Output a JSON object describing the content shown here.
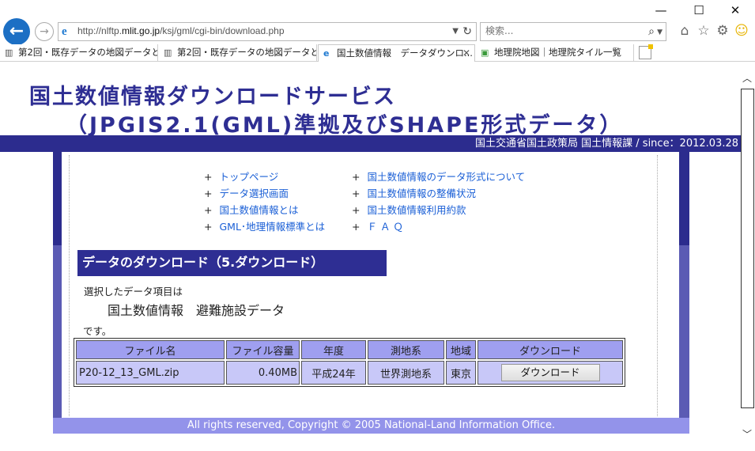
{
  "window": {
    "minimize": "—",
    "maximize": "☐",
    "close": "✕"
  },
  "toolbar": {
    "back_icon": "←",
    "forward_icon": "→",
    "url_prefix": "http://nlftp.",
    "url_domain": "mlit.go.jp",
    "url_path": "/ksj/gml/cgi-bin/download.php",
    "search_placeholder": "検索...",
    "icons": [
      "home-icon",
      "favorites-star-icon",
      "settings-gear-icon",
      "smiley-feedback-icon"
    ]
  },
  "tabs": [
    {
      "label": "第2回・既存データの地図データと...",
      "icon": "book-icon"
    },
    {
      "label": "第2回・既存データの地図データと...",
      "icon": "book-icon"
    },
    {
      "label": "国土数値情報　データダウンロ...",
      "icon": "ie-icon",
      "active": true
    },
    {
      "label": "地理院地図｜地理院タイル一覧",
      "icon": "map-icon"
    }
  ],
  "header": {
    "title_line1": "国土数値情報ダウンロードサービス",
    "title_line2": "（JPGIS2.1(GML)準拠及びSHAPE形式データ）",
    "bar_text": "国土交通省国土政策局  国土情報課   /   since：2012.03.28"
  },
  "nav": {
    "left": [
      "トップページ",
      "データ選択画面",
      "国土数値情報とは",
      "GML･地理情報標準とは"
    ],
    "right": [
      "国土数値情報のデータ形式について",
      "国土数値情報の整備状況",
      "国土数値情報利用約款",
      "Ｆ Ａ Ｑ"
    ],
    "bullet": "+"
  },
  "section": {
    "title": "データのダウンロード（5.ダウンロード）",
    "intro": "選択したデータ項目は",
    "item": "国土数値情報　避難施設データ",
    "outro": "です。"
  },
  "table": {
    "headers": [
      "ファイル名",
      "ファイル容量",
      "年度",
      "測地系",
      "地域",
      "ダウンロード"
    ],
    "rows": [
      {
        "file": "P20-12_13_GML.zip",
        "size": "0.40MB",
        "year": "平成24年",
        "datum": "世界測地系",
        "region": "東京",
        "button": "ダウンロード"
      }
    ]
  },
  "footer": {
    "text": "All rights reserved, Copyright © 2005 National-Land Information Office."
  },
  "scrollbar": {
    "up": "︿",
    "down": "﹀"
  }
}
